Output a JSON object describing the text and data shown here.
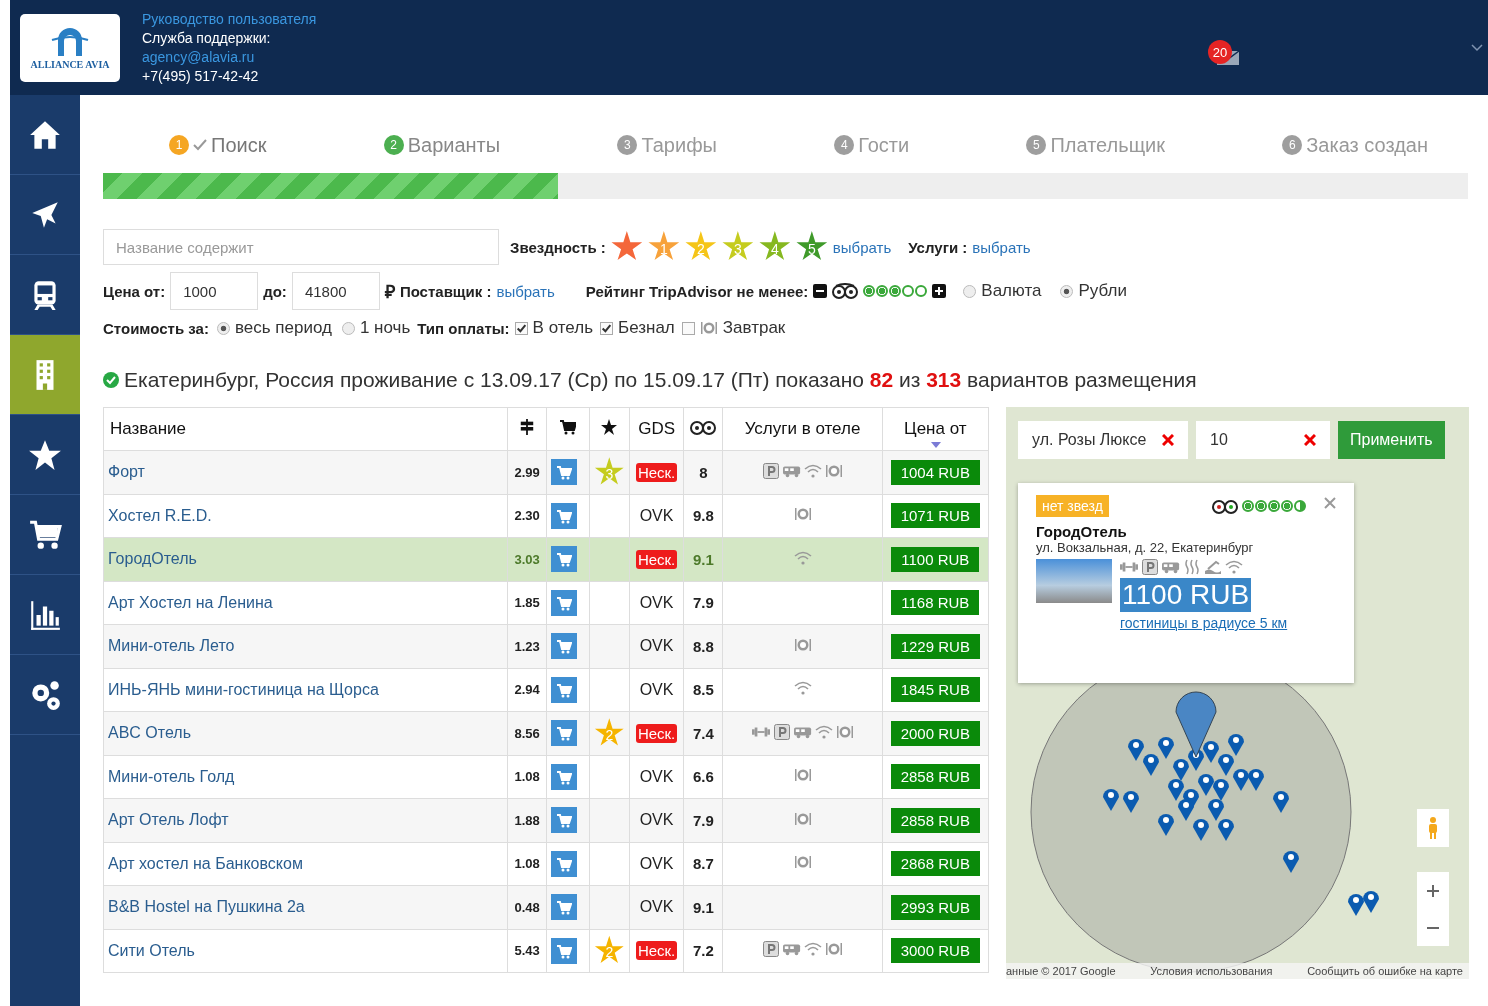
{
  "header": {
    "logo_text": "ALLIANCE AVIA",
    "lines": [
      {
        "text": "Руководство пользователя",
        "kind": "link"
      },
      {
        "text": "Служба поддержки:",
        "kind": "plain"
      },
      {
        "text": "agency@alavia.ru",
        "kind": "link"
      },
      {
        "text": "+7(495) 517-42-42",
        "kind": "plain"
      }
    ],
    "mail_count": "20"
  },
  "sidebar": {
    "items": [
      {
        "kind": "home",
        "selected": false
      },
      {
        "kind": "plane",
        "selected": false
      },
      {
        "kind": "train",
        "selected": false
      },
      {
        "kind": "hotel",
        "selected": true
      },
      {
        "kind": "star",
        "selected": false
      },
      {
        "kind": "cart",
        "selected": false
      },
      {
        "kind": "chart",
        "selected": false
      },
      {
        "kind": "gears",
        "selected": false
      }
    ]
  },
  "steps": [
    {
      "number": "1",
      "label": "Поиск",
      "kind": "done"
    },
    {
      "number": "2",
      "label": "Варианты",
      "kind": "active"
    },
    {
      "number": "3",
      "label": "Тарифы",
      "kind": "pending"
    },
    {
      "number": "4",
      "label": "Гости",
      "kind": "pending"
    },
    {
      "number": "5",
      "label": "Плательщик",
      "kind": "pending"
    },
    {
      "number": "6",
      "label": "Заказ создан",
      "kind": "pending"
    }
  ],
  "progress": {
    "level": 0.333
  },
  "filters": {
    "name_placeholder": "Название содержит",
    "stars_label": "Звездность :",
    "stars": [
      {
        "color": "#f4673a"
      },
      {
        "label": "1",
        "color": "#f7a23b"
      },
      {
        "label": "2",
        "color": "#f5c518"
      },
      {
        "label": "3",
        "color": "#c5cc1f"
      },
      {
        "label": "4",
        "color": "#86b820"
      },
      {
        "label": "5",
        "color": "#3f9a2a"
      }
    ],
    "stars_link": "выбрать",
    "services_label": "Услуги :",
    "services_link": "выбрать",
    "price_from_label": "Цена от:",
    "price_from": "1000",
    "price_to_label": "до:",
    "price_to": "41800",
    "currency_sign": "₽",
    "supplier_label": "Поставщик :",
    "supplier_link": "выбрать",
    "tripadvisor_label": "Рейтинг TripAdvisor не менее:",
    "tripadvisor": {
      "stars": 3
    },
    "currency": [
      {
        "label": "Валюта",
        "selected": false
      },
      {
        "label": "Рубли",
        "selected": true
      }
    ],
    "cost_label": "Стоимость за:",
    "cost": [
      {
        "label": "весь период",
        "selected": true
      },
      {
        "label": "1 ночь",
        "selected": false
      }
    ],
    "payment_label": "Тип оплаты:",
    "payment": [
      {
        "label": "В отель",
        "checked": true,
        "kind": "plain"
      },
      {
        "label": "Безнал",
        "checked": true,
        "kind": "plain"
      },
      {
        "label": "Завтрак",
        "checked": false,
        "kind": "meal"
      }
    ]
  },
  "summary": "Екатеринбург, Россия проживание с 13.09.17 (Ср) по 15.09.17 (Пт) показано **82** из **313** вариантов размещения",
  "table": {
    "columns": [
      {
        "kind": "text",
        "label": "Название"
      },
      {
        "kind": "signpost"
      },
      {
        "kind": "cart"
      },
      {
        "kind": "star"
      },
      {
        "kind": "text",
        "label": "GDS"
      },
      {
        "kind": "owl"
      },
      {
        "kind": "text",
        "label": "Услуги в отеле"
      },
      {
        "kind": "text",
        "label": "Цена от",
        "sorted": true
      }
    ],
    "rows": [
      {
        "name": "Форт",
        "distance": "2.99",
        "hotel_stars": "3",
        "color": "#c5cc1f",
        "gds": {
          "kind": "badge",
          "text": "Неск."
        },
        "rating": "8",
        "services": [
          {
            "kind": "parking"
          },
          {
            "kind": "bus"
          },
          {
            "kind": "wifi"
          },
          {
            "kind": "meal"
          }
        ],
        "price": "1004 RUB",
        "selected": false
      },
      {
        "name": "Хостел R.E.D.",
        "distance": "2.30",
        "gds": {
          "kind": "text",
          "text": "OVK"
        },
        "rating": "9.8",
        "services": [
          {
            "kind": "meal"
          }
        ],
        "price": "1071 RUB",
        "selected": false
      },
      {
        "name": "ГородОтель",
        "distance": "3.03",
        "gds": {
          "kind": "badge",
          "text": "Неск."
        },
        "rating": "9.1",
        "services": [
          {
            "kind": "wifi"
          }
        ],
        "price": "1100 RUB",
        "selected": true
      },
      {
        "name": "Арт Хостел на Ленина",
        "distance": "1.85",
        "gds": {
          "kind": "text",
          "text": "OVK"
        },
        "rating": "7.9",
        "price": "1168 RUB",
        "selected": false
      },
      {
        "name": "Мини-отель Лето",
        "distance": "1.23",
        "gds": {
          "kind": "text",
          "text": "OVK"
        },
        "rating": "8.8",
        "services": [
          {
            "kind": "meal"
          }
        ],
        "price": "1229 RUB",
        "selected": false
      },
      {
        "name": "ИНЬ-ЯНЬ мини-гостиница на Щорса",
        "distance": "2.94",
        "gds": {
          "kind": "text",
          "text": "OVK"
        },
        "rating": "8.5",
        "services": [
          {
            "kind": "wifi"
          }
        ],
        "price": "1845 RUB",
        "selected": false
      },
      {
        "name": "ABC Отель",
        "distance": "8.56",
        "hotel_stars": "2",
        "color": "#f5b400",
        "gds": {
          "kind": "badge",
          "text": "Неск."
        },
        "rating": "7.4",
        "services": [
          {
            "kind": "gym"
          },
          {
            "kind": "parking"
          },
          {
            "kind": "bus"
          },
          {
            "kind": "wifi"
          },
          {
            "kind": "meal"
          }
        ],
        "price": "2000 RUB",
        "selected": false
      },
      {
        "name": "Мини-отель Голд",
        "distance": "1.08",
        "gds": {
          "kind": "text",
          "text": "OVK"
        },
        "rating": "6.6",
        "services": [
          {
            "kind": "meal"
          }
        ],
        "price": "2858 RUB",
        "selected": false
      },
      {
        "name": "Арт Отель Лофт",
        "distance": "1.88",
        "gds": {
          "kind": "text",
          "text": "OVK"
        },
        "rating": "7.9",
        "services": [
          {
            "kind": "meal"
          }
        ],
        "price": "2858 RUB",
        "selected": false
      },
      {
        "name": "Арт хостел на Банковском",
        "distance": "1.08",
        "gds": {
          "kind": "text",
          "text": "OVK"
        },
        "rating": "8.7",
        "services": [
          {
            "kind": "meal"
          }
        ],
        "price": "2868 RUB",
        "selected": false
      },
      {
        "name": "B&B Hostel на Пушкина 2а",
        "distance": "0.48",
        "gds": {
          "kind": "text",
          "text": "OVK"
        },
        "rating": "9.1",
        "price": "2993 RUB",
        "selected": false
      },
      {
        "name": "Сити Отель",
        "distance": "5.43",
        "hotel_stars": "2",
        "color": "#f5b400",
        "gds": {
          "kind": "badge",
          "text": "Неск."
        },
        "rating": "7.2",
        "services": [
          {
            "kind": "parking"
          },
          {
            "kind": "bus"
          },
          {
            "kind": "wifi"
          },
          {
            "kind": "meal"
          }
        ],
        "price": "3000 RUB",
        "selected": false
      }
    ]
  },
  "map": {
    "address": "ул. Розы Люксе",
    "radius": "10",
    "apply": "Применить",
    "popup": {
      "badge": "нет звезд",
      "tripadvisor": {
        "stars": 4.5
      },
      "name": "ГородОтель",
      "address": "ул. Вокзальная, д. 22, Екатеринбург",
      "services": [
        {
          "kind": "gym"
        },
        {
          "kind": "parking"
        },
        {
          "kind": "bus"
        },
        {
          "kind": "heat"
        },
        {
          "kind": "pool"
        },
        {
          "kind": "wifi"
        }
      ],
      "price": "1100 RUB",
      "link": "гостиницы в радиусе 5 км"
    },
    "footer": [
      "анные © 2017 Google",
      "Условия использования",
      "Сообщить об ошибке на карте"
    ]
  }
}
